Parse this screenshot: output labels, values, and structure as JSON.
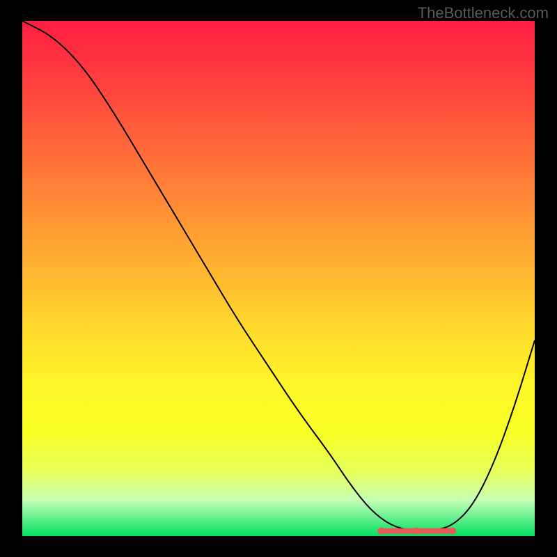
{
  "watermark": "TheBottleneck.com",
  "chart_data": {
    "type": "line",
    "title": "",
    "xlabel": "",
    "ylabel": "",
    "xlim": [
      0,
      100
    ],
    "ylim": [
      0,
      100
    ],
    "series": [
      {
        "name": "bottleneck-curve",
        "x": [
          0,
          6,
          12,
          18,
          24,
          30,
          36,
          42,
          48,
          54,
          60,
          64,
          68,
          72,
          76,
          80,
          84,
          88,
          92,
          96,
          100
        ],
        "values": [
          100,
          97,
          91,
          82,
          72,
          62,
          52,
          42,
          33,
          24,
          16,
          10,
          5,
          2,
          1,
          1,
          2,
          6,
          14,
          25,
          38
        ]
      }
    ],
    "optimal_zone": {
      "x_start": 70,
      "x_end": 84,
      "y": 1
    },
    "background_gradient": {
      "top": "#ff1e42",
      "mid": "#ffda2c",
      "bottom": "#00e060"
    }
  }
}
